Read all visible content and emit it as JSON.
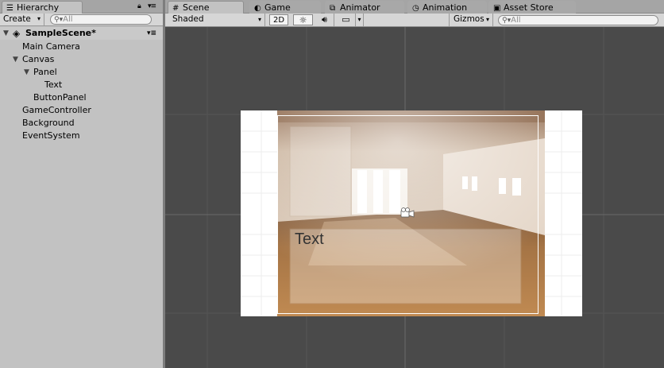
{
  "hierarchy": {
    "tab_label": "Hierarchy",
    "create_label": "Create",
    "search_placeholder": "All",
    "scene_name": "SampleScene*",
    "items": [
      {
        "label": "Main Camera"
      },
      {
        "label": "Canvas"
      },
      {
        "label": "Panel"
      },
      {
        "label": "Text"
      },
      {
        "label": "ButtonPanel"
      },
      {
        "label": "GameController"
      },
      {
        "label": "Background"
      },
      {
        "label": "EventSystem"
      }
    ]
  },
  "scene_tabs": {
    "scene": "Scene",
    "game": "Game",
    "animator": "Animator",
    "animation": "Animation",
    "asset_store": "Asset Store"
  },
  "scene_toolbar": {
    "shading_mode": "Shaded",
    "mode_2d": "2D",
    "gizmos": "Gizmos",
    "search_placeholder": "All"
  },
  "viewport": {
    "ui_text": "Text"
  },
  "colors": {
    "viewport_bg": "#4a4a4a",
    "panel_bg": "#c2c2c2",
    "canvas_white": "#ffffff",
    "floor_wood": "#a87846"
  },
  "icons": [
    "hierarchy-icon",
    "lock-icon",
    "menu-icon",
    "unity-logo-icon",
    "grid-icon",
    "game-icon",
    "animator-icon",
    "clock-icon",
    "store-icon",
    "sun-icon",
    "audio-icon",
    "image-icon",
    "camera-gizmo-icon",
    "search-icon"
  ]
}
